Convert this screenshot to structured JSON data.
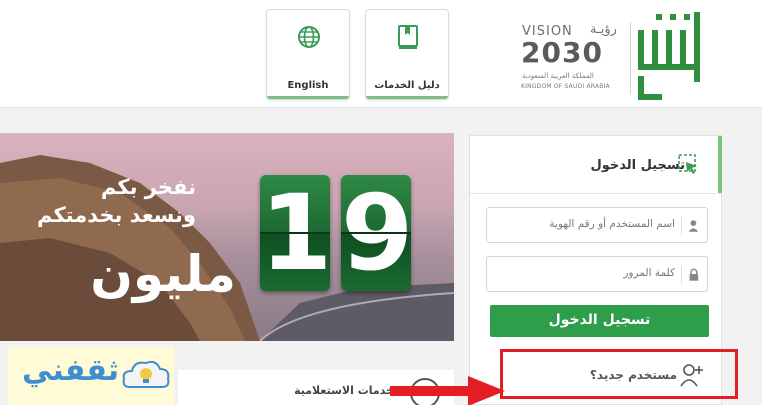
{
  "header": {
    "logo_alt": "ابشر",
    "vision": {
      "label_en": "VISION",
      "label_ar": "رؤيـة",
      "year": "2030",
      "kingdom_ar": "المملكة العربية السعودية",
      "kingdom_en": "KINGDOM OF SAUDI ARABIA"
    },
    "buttons": [
      {
        "label": "دليل الخدمات",
        "icon": "book-icon"
      },
      {
        "label": "English",
        "icon": "globe-icon"
      }
    ],
    "accent_color": "#7fbf83"
  },
  "banner": {
    "line1": "نفخر بكم",
    "line2": "ونسعد بخدمتكم",
    "big_word": "مليون",
    "counter_digits": [
      "1",
      "9"
    ],
    "counter_color": "#1d6a32"
  },
  "login": {
    "title": "تسجيل الدخول",
    "username_placeholder": "اسم المستخدم أو رقم الهوية",
    "password_placeholder": "كلمة المرور",
    "submit_label": "تسجيل الدخول",
    "new_user_label": "مستخدم جديد؟",
    "button_color": "#2f9e4b",
    "highlight_color": "#e31e24"
  },
  "inquiry": {
    "label": "خدمات الاستعلامية"
  },
  "watermark": {
    "text": "ثقفني"
  }
}
